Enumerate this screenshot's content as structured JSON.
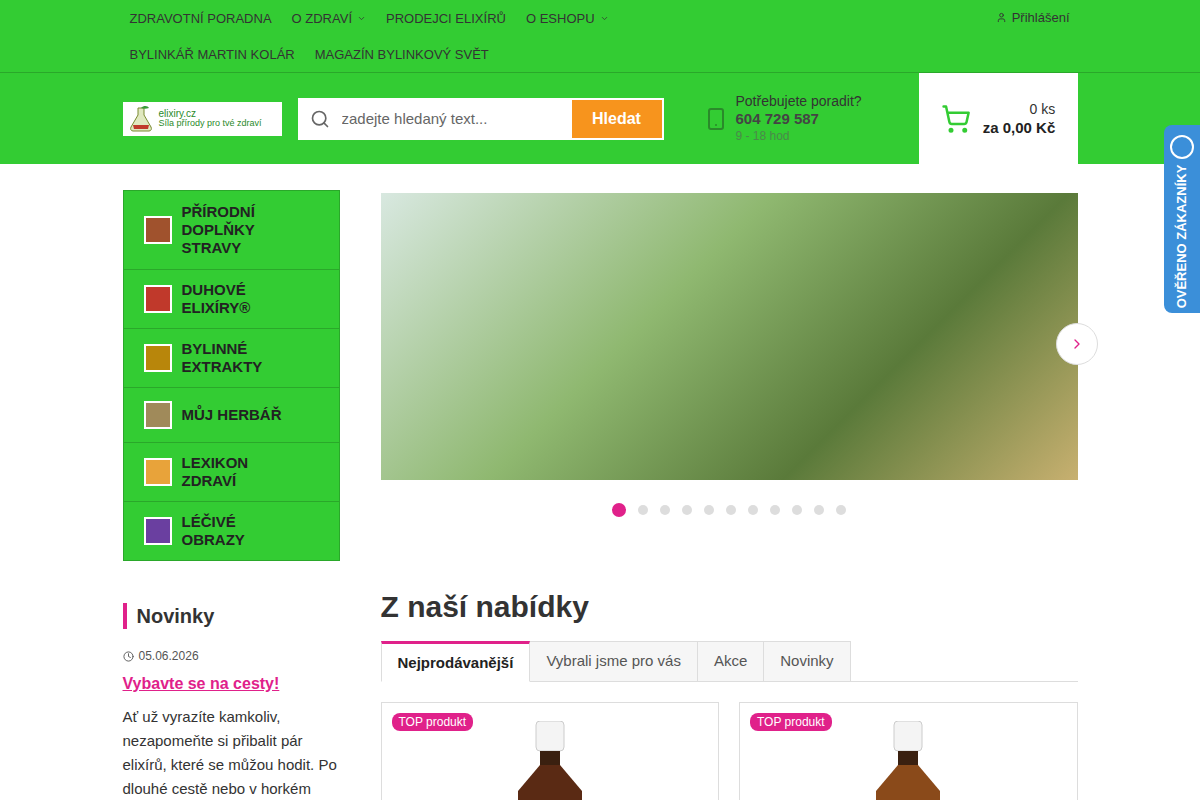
{
  "nav": {
    "rows": [
      [
        {
          "label": "ZDRAVOTNÍ PORADNA",
          "has_menu": false
        },
        {
          "label": "O ZDRAVÍ",
          "has_menu": true
        },
        {
          "label": "PRODEJCI ELIXÍRŮ",
          "has_menu": false
        },
        {
          "label": "O ESHOPU",
          "has_menu": true
        }
      ],
      [
        {
          "label": "BYLINKÁŘ MARTIN KOLÁR",
          "has_menu": false
        },
        {
          "label": "MAGAZÍN BYLINKOVÝ SVĚT",
          "has_menu": false
        }
      ]
    ],
    "login": "Přihlášení"
  },
  "logo": {
    "name": "elixiry.cz",
    "slogan": "Síla přírody pro tvé zdraví"
  },
  "search": {
    "placeholder": "zadejte hledaný text...",
    "button": "Hledat"
  },
  "help": {
    "label": "Potřebujete poradit?",
    "phone": "604 729 587",
    "hours": "9 - 18 hod"
  },
  "cart": {
    "count": "0 ks",
    "total": "za 0,00 Kč"
  },
  "categories": [
    {
      "label": "PŘÍRODNÍ DOPLŇKY STRAVY",
      "color": "#a0522d"
    },
    {
      "label": "DUHOVÉ ELIXÍRY®",
      "color": "#c0392b"
    },
    {
      "label": "BYLINNÉ EXTRAKTY",
      "color": "#b8860b"
    },
    {
      "label": "MŮJ HERBÁŘ",
      "color": "#a08a5a"
    },
    {
      "label": "LEXIKON ZDRAVÍ",
      "color": "#e8a33a"
    },
    {
      "label": "LÉČIVÉ OBRAZY",
      "color": "#6a3fa0"
    }
  ],
  "carousel": {
    "dots": [
      {
        "selected": true
      },
      {
        "selected": false
      },
      {
        "selected": false
      },
      {
        "selected": false
      },
      {
        "selected": false
      },
      {
        "selected": false
      },
      {
        "selected": false
      },
      {
        "selected": false
      },
      {
        "selected": false
      },
      {
        "selected": false
      },
      {
        "selected": false
      }
    ]
  },
  "news": {
    "heading": "Novinky",
    "date": "05.06.2026",
    "title": "Vybavte se na cesty!",
    "text": "Ať už vyrazíte kamkoliv, nezapomeňte si přibalit pár elixírů, které se můžou hodit.  Po dlouhé cestě nebo v horkém"
  },
  "offer": {
    "heading": "Z naší nabídky",
    "tabs": [
      {
        "label": "Nejprodávanější",
        "selected": true
      },
      {
        "label": "Vybrali jsme pro vás",
        "selected": false
      },
      {
        "label": "Akce",
        "selected": false
      },
      {
        "label": "Novinky",
        "selected": false
      }
    ],
    "products": [
      {
        "badge": "TOP produkt",
        "color": "#5a2a14"
      },
      {
        "badge": "TOP produkt",
        "color": "#8a4a1a"
      }
    ]
  },
  "verified": {
    "label": "OVĚŘENO ZÁKAZNÍKY"
  }
}
